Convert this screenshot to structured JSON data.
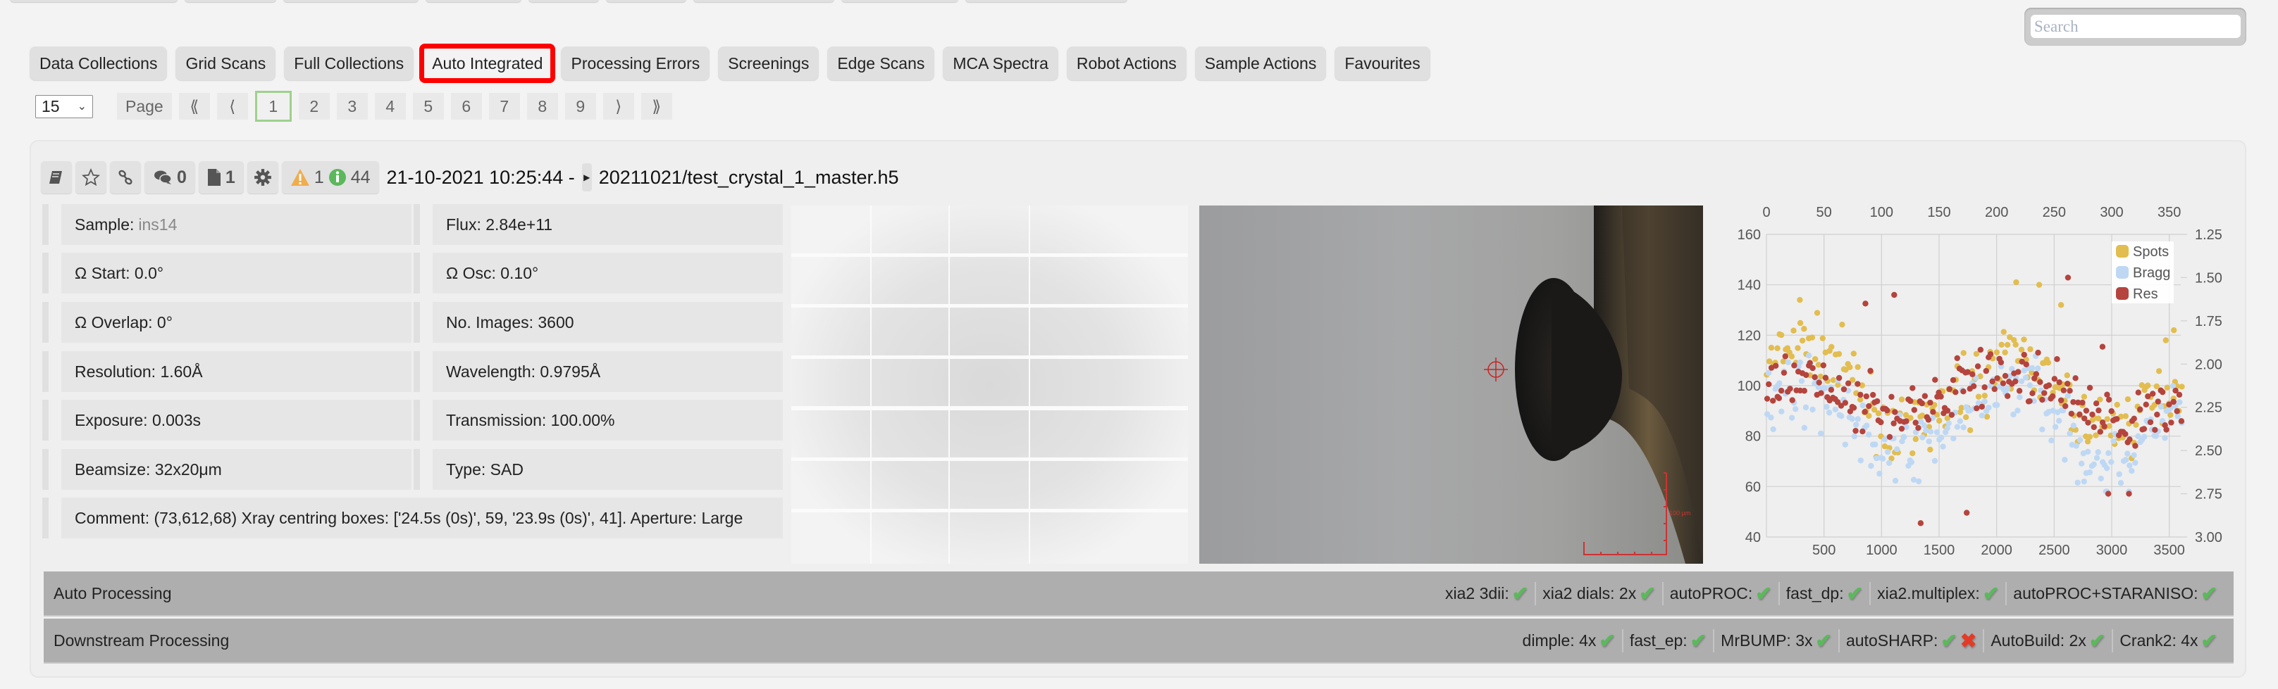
{
  "search": {
    "placeholder": "Search",
    "value": ""
  },
  "tabs": [
    {
      "label": "Data Collections",
      "active": false
    },
    {
      "label": "Grid Scans",
      "active": false
    },
    {
      "label": "Full Collections",
      "active": false
    },
    {
      "label": "Auto Integrated",
      "active": true
    },
    {
      "label": "Processing Errors",
      "active": false
    },
    {
      "label": "Screenings",
      "active": false
    },
    {
      "label": "Edge Scans",
      "active": false
    },
    {
      "label": "MCA Spectra",
      "active": false
    },
    {
      "label": "Robot Actions",
      "active": false
    },
    {
      "label": "Sample Actions",
      "active": false
    },
    {
      "label": "Favourites",
      "active": false
    }
  ],
  "pager": {
    "per_page": "15",
    "page_label": "Page",
    "first": "⟪",
    "prev": "⟨",
    "pages": [
      "1",
      "2",
      "3",
      "4",
      "5",
      "6",
      "7",
      "8",
      "9"
    ],
    "current": "1",
    "next": "⟩",
    "last": "⟫"
  },
  "collection": {
    "toolbar": {
      "comments_count": "0",
      "attachments_count": "1",
      "warnings_count": "1",
      "info_count": "44"
    },
    "datetime": "21-10-2021 10:25:44 -",
    "file": "20211021/test_crystal_1_master.h5",
    "info": {
      "sample_label": "Sample:",
      "sample_value": "ins14",
      "flux": "Flux: 2.84e+11",
      "omega_start": "Ω Start: 0.0°",
      "omega_osc": "Ω Osc: 0.10°",
      "omega_overlap": "Ω Overlap: 0°",
      "no_images": "No. Images: 3600",
      "resolution": "Resolution: 1.60Å",
      "wavelength": "Wavelength: 0.9795Å",
      "exposure": "Exposure: 0.003s",
      "transmission": "Transmission: 100.00%",
      "beamsize": "Beamsize: 32x20μm",
      "type": "Type: SAD",
      "comment": "Comment: (73,612,68) Xray centring boxes: ['24.5s (0s)', 59, '23.9s (0s)', 41]. Aperture: Large"
    },
    "snapshot_scale_label": "100 µm"
  },
  "chart_data": {
    "type": "scatter",
    "title": "",
    "x_bottom": {
      "label": "",
      "range": [
        0,
        3600
      ],
      "ticks": [
        "500",
        "1000",
        "1500",
        "2000",
        "2500",
        "3000",
        "3500"
      ]
    },
    "x_top": {
      "label": "",
      "range": [
        0,
        360
      ],
      "ticks": [
        "0",
        "50",
        "100",
        "150",
        "200",
        "250",
        "300",
        "350"
      ]
    },
    "y_left": {
      "label": "",
      "range": [
        40,
        160
      ],
      "ticks": [
        "40",
        "60",
        "80",
        "100",
        "120",
        "140",
        "160"
      ]
    },
    "y_right": {
      "label": "",
      "range": [
        1.25,
        3.0
      ],
      "inverted": true,
      "ticks": [
        "1.25",
        "1.50",
        "1.75",
        "2.00",
        "2.25",
        "2.50",
        "2.75",
        "3.00"
      ]
    },
    "grid": true,
    "legend": "top-right",
    "series": [
      {
        "name": "Spots",
        "color": "#e2bd4f",
        "axis": "left",
        "trend": [
          [
            0,
            108
          ],
          [
            300,
            116
          ],
          [
            600,
            112
          ],
          [
            800,
            98
          ],
          [
            1000,
            84
          ],
          [
            1300,
            82
          ],
          [
            1500,
            90
          ],
          [
            1800,
            100
          ],
          [
            2100,
            112
          ],
          [
            2300,
            110
          ],
          [
            2500,
            96
          ],
          [
            2800,
            84
          ],
          [
            3100,
            84
          ],
          [
            3300,
            92
          ],
          [
            3600,
            102
          ]
        ],
        "outliers": [
          [
            290,
            134
          ],
          [
            2170,
            141
          ],
          [
            2370,
            140
          ],
          [
            2560,
            132
          ],
          [
            3470,
            118
          ],
          [
            3540,
            122
          ]
        ]
      },
      {
        "name": "Bragg",
        "color": "#bed8f4",
        "axis": "left",
        "trend": [
          [
            0,
            96
          ],
          [
            300,
            100
          ],
          [
            600,
            94
          ],
          [
            800,
            82
          ],
          [
            1000,
            74
          ],
          [
            1300,
            74
          ],
          [
            1500,
            82
          ],
          [
            1800,
            90
          ],
          [
            2100,
            100
          ],
          [
            2300,
            104
          ],
          [
            2500,
            86
          ],
          [
            2800,
            72
          ],
          [
            3100,
            72
          ],
          [
            3300,
            80
          ],
          [
            3600,
            92
          ]
        ],
        "outliers": [
          [
            2950,
            58
          ],
          [
            2960,
            58
          ],
          [
            2760,
            62
          ],
          [
            3150,
            58
          ]
        ]
      },
      {
        "name": "Res",
        "color": "#b4443d",
        "axis": "right",
        "trend": [
          [
            0,
            2.1
          ],
          [
            300,
            2.05
          ],
          [
            600,
            2.15
          ],
          [
            800,
            2.25
          ],
          [
            1000,
            2.25
          ],
          [
            1300,
            2.3
          ],
          [
            1500,
            2.2
          ],
          [
            1800,
            2.1
          ],
          [
            2100,
            2.05
          ],
          [
            2300,
            2.1
          ],
          [
            2500,
            2.15
          ],
          [
            2800,
            2.3
          ],
          [
            3100,
            2.35
          ],
          [
            3300,
            2.25
          ],
          [
            3600,
            2.2
          ]
        ],
        "outliers": [
          [
            860,
            1.65
          ],
          [
            1110,
            1.6
          ],
          [
            1340,
            2.92
          ],
          [
            1740,
            2.86
          ],
          [
            2620,
            1.5
          ],
          [
            2920,
            1.9
          ],
          [
            2970,
            2.75
          ],
          [
            3150,
            2.75
          ]
        ]
      }
    ]
  },
  "auto_processing": {
    "title": "Auto Processing",
    "items": [
      {
        "label": "xia2 3dii:",
        "status": [
          "ok"
        ]
      },
      {
        "label": "xia2 dials: 2x",
        "status": [
          "ok"
        ]
      },
      {
        "label": "autoPROC:",
        "status": [
          "ok"
        ]
      },
      {
        "label": "fast_dp:",
        "status": [
          "ok"
        ]
      },
      {
        "label": "xia2.multiplex:",
        "status": [
          "ok"
        ]
      },
      {
        "label": "autoPROC+STARANISO:",
        "status": [
          "ok"
        ]
      }
    ]
  },
  "downstream_processing": {
    "title": "Downstream Processing",
    "items": [
      {
        "label": "dimple: 4x",
        "status": [
          "ok"
        ]
      },
      {
        "label": "fast_ep:",
        "status": [
          "ok"
        ]
      },
      {
        "label": "MrBUMP: 3x",
        "status": [
          "ok"
        ]
      },
      {
        "label": "autoSHARP:",
        "status": [
          "ok",
          "fail"
        ]
      },
      {
        "label": "AutoBuild: 2x",
        "status": [
          "ok"
        ]
      },
      {
        "label": "Crank2: 4x",
        "status": [
          "ok"
        ]
      }
    ]
  },
  "icons": {
    "ok": "✔",
    "fail": "✖"
  }
}
